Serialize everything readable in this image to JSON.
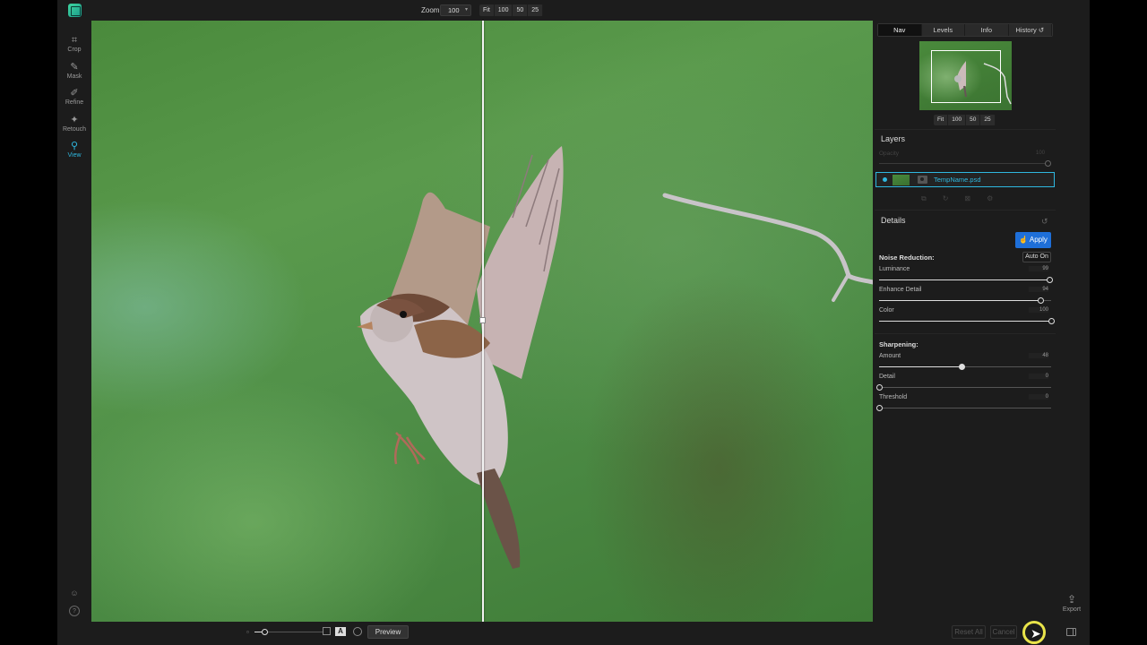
{
  "toolbar": {
    "zoom_label": "Zoom",
    "zoom_value": "100",
    "zoom_presets": [
      "Fit",
      "100",
      "50",
      "25"
    ]
  },
  "tools": [
    {
      "label": "Crop",
      "icon": "crop-icon"
    },
    {
      "label": "Mask",
      "icon": "mask-brush-icon"
    },
    {
      "label": "Refine",
      "icon": "refine-brush-icon"
    },
    {
      "label": "Retouch",
      "icon": "retouch-icon"
    },
    {
      "label": "View",
      "icon": "view-icon",
      "active": true
    }
  ],
  "nav_panel": {
    "tabs": [
      "Nav",
      "Levels",
      "Info",
      "History"
    ],
    "active_tab": "Nav",
    "presets": [
      "Fit",
      "100",
      "50",
      "25"
    ]
  },
  "layers": {
    "title": "Layers",
    "opacity_label": "Opacity",
    "opacity_value": "100",
    "layer_name": "TempName.psd"
  },
  "details": {
    "title": "Details",
    "apply_label": "Apply",
    "auto_label": "Auto On",
    "noise_reduction": {
      "title": "Noise Reduction:",
      "sliders": [
        {
          "label": "Luminance",
          "value": "99",
          "level": 0.99
        },
        {
          "label": "Enhance Detail",
          "value": "94",
          "level": 0.94
        },
        {
          "label": "Color",
          "value": "100",
          "level": 1.0
        }
      ]
    },
    "sharpening": {
      "title": "Sharpening:",
      "sliders": [
        {
          "label": "Amount",
          "value": "48",
          "level": 0.48
        },
        {
          "label": "Detail",
          "value": "0",
          "level": 0
        },
        {
          "label": "Threshold",
          "value": "0",
          "level": 0
        }
      ]
    }
  },
  "bottom": {
    "preview_label": "Preview",
    "reset_all_label": "Reset All",
    "cancel_label": "Cancel",
    "export_label": "Export"
  },
  "colors": {
    "accent": "#2fb8e0",
    "apply_button": "#1e6fd9",
    "cursor_highlight": "#e9e44a"
  }
}
